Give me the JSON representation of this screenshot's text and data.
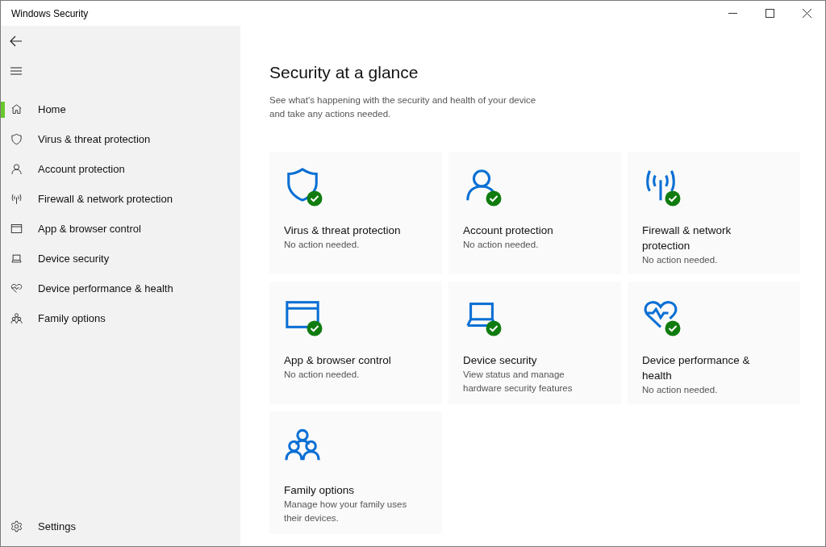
{
  "window": {
    "title": "Windows Security"
  },
  "sidebar": {
    "items": [
      {
        "kind": "home",
        "label": "Home",
        "selected": true
      },
      {
        "kind": "shield",
        "label": "Virus & threat protection",
        "selected": false
      },
      {
        "kind": "person",
        "label": "Account protection",
        "selected": false
      },
      {
        "kind": "antenna",
        "label": "Firewall & network protection",
        "selected": false
      },
      {
        "kind": "browser",
        "label": "App & browser control",
        "selected": false
      },
      {
        "kind": "laptop",
        "label": "Device security",
        "selected": false
      },
      {
        "kind": "heart",
        "label": "Device performance & health",
        "selected": false
      },
      {
        "kind": "family",
        "label": "Family options",
        "selected": false
      }
    ],
    "settings": {
      "label": "Settings"
    }
  },
  "main": {
    "heading": "Security at a glance",
    "subtitle": "See what's happening with the security and health of your device and take any actions needed.",
    "cards": [
      {
        "kind": "shield",
        "title": "Virus & threat protection",
        "status": "No action needed.",
        "healthy": true
      },
      {
        "kind": "person",
        "title": "Account protection",
        "status": "No action needed.",
        "healthy": true
      },
      {
        "kind": "antenna",
        "title": "Firewall & network protection",
        "status": "No action needed.",
        "healthy": true
      },
      {
        "kind": "browser",
        "title": "App & browser control",
        "status": "No action needed.",
        "healthy": true
      },
      {
        "kind": "laptop",
        "title": "Device security",
        "status": "View status and manage hardware security features",
        "healthy": true
      },
      {
        "kind": "heart",
        "title": "Device performance & health",
        "status": "No action needed.",
        "healthy": true
      },
      {
        "kind": "family",
        "title": "Family options",
        "status": "Manage how your family uses their devices.",
        "healthy": false
      }
    ]
  }
}
